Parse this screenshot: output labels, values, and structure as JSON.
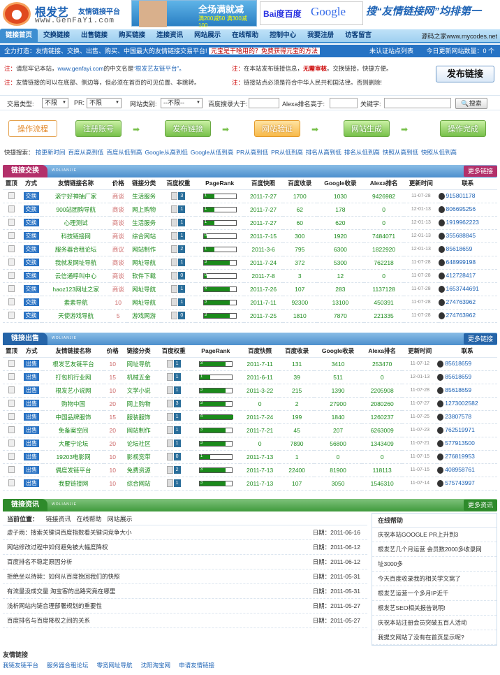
{
  "header": {
    "brand": "根发艺",
    "brand_sub": "友情链接平台",
    "brand_url": "www.GenFaYi.com",
    "ad1_title": "全场满就减",
    "ad1_sub": "满200减50 满300减100",
    "ad_baidu": "Bai度百度",
    "ad_google": "Google",
    "slogan": "搜“友情链接网”均排第一"
  },
  "nav": {
    "items": [
      "链接首页",
      "交换链接",
      "出售链接",
      "购买链接",
      "连接资讯",
      "网站展示",
      "在线帮助",
      "控制中心",
      "我要注册",
      "访客留言"
    ],
    "right": "源码之家www.mycodes.net"
  },
  "tagbar": {
    "text": "全力打造：友情链接、交换、出售、购买、中国最大的友情链接交易平台!",
    "highlight": "元宝是干啥用的？免费获得元宝的方法",
    "right1": "未认证站点列表",
    "right2": "今日更新网站数量：0 个"
  },
  "notices": [
    {
      "mark": "注：",
      "text": "请您牢记本站，",
      "url": "www.genfayi.com",
      "text2": "的中文名是",
      "name": "“根发艺友链平台”。"
    },
    {
      "mark": "注：",
      "text": "在本站发布链接信息，",
      "red": "无需审核",
      "text2": "。交换链接，快捷方便。"
    },
    {
      "mark": "注：",
      "text": "友情链接的可以在底部、侧边等，但必须在首页的可见位置、非跳转。"
    },
    {
      "mark": "注：",
      "text": "链接站点必须是符合中华人民共和国法律。否则删除!"
    }
  ],
  "publish_button": "发布链接",
  "filter": {
    "type_label": "交易类型:",
    "type_val": "不限",
    "pr_label": "PR:",
    "pr_val": "不限",
    "cat_label": "网站类别:",
    "cat_val": "--不限--",
    "baidu_label": "百度搜录大于:",
    "alexa_label": "Alexa排名高于:",
    "kw_label": "关键字:",
    "search": "搜索"
  },
  "flow": [
    "操作流程",
    "注册账号",
    "发布链接",
    "网站验证",
    "网站生成",
    "操作完成"
  ],
  "quick": {
    "label": "快捷搜索：",
    "links": [
      "按更新时间",
      "百度从高到低",
      "百度从低到高",
      "Google从高到低",
      "Google从低到高",
      "PR从高到低",
      "PR从低到高",
      "排名从高到低",
      "排名从低到高",
      "快照从高到低",
      "快照从低到高"
    ]
  },
  "exchange": {
    "title": "链接交换",
    "sub": "WOLIANJIE",
    "more": "更多链接",
    "cols": [
      "置顶",
      "方式",
      "友情链接名称",
      "价格",
      "链接分类",
      "百度权重",
      "PageRank",
      "百度快照",
      "百度收录",
      "Google收录",
      "Alexa排名",
      "更新时间",
      "联系"
    ],
    "rows": [
      {
        "mode": "交换",
        "name": "滚宁好神抽厂家",
        "price": "商谈",
        "cat": "生活服务",
        "bw": "3",
        "pr": "1",
        "snap": "2011-7-27",
        "bd": "1700",
        "gg": "1030",
        "alexa": "9426982",
        "upd": "11-07-28",
        "qq": "915801178"
      },
      {
        "mode": "交换",
        "name": "900站团购导航",
        "price": "商谈",
        "cat": "网上购物",
        "bw": "1",
        "pr": "1",
        "snap": "2011-7-27",
        "bd": "62",
        "gg": "178",
        "alexa": "0",
        "upd": "12-01-13",
        "qq": "806695256"
      },
      {
        "mode": "交换",
        "name": "心理测试",
        "price": "商谈",
        "cat": "生活服务",
        "bw": "1",
        "pr": "1",
        "snap": "2011-7-27",
        "bd": "60",
        "gg": "620",
        "alexa": "0",
        "upd": "12-01-13",
        "qq": "1919962223"
      },
      {
        "mode": "交换",
        "name": "科技链接网",
        "price": "商谈",
        "cat": "综合网站",
        "bw": "1",
        "pr": "0",
        "snap": "2011-7-15",
        "bd": "300",
        "gg": "1920",
        "alexa": "7484071",
        "upd": "12-01-13",
        "qq": "355688845"
      },
      {
        "mode": "交换",
        "name": "服务器合租论坛",
        "price": "商议",
        "cat": "网站制作",
        "bw": "2",
        "pr": "1",
        "snap": "2011-3-6",
        "bd": "795",
        "gg": "6300",
        "alexa": "1822920",
        "upd": "12-01-13",
        "qq": "85618659"
      },
      {
        "mode": "交换",
        "name": "我就发网址导航",
        "price": "商谈",
        "cat": "网址导航",
        "bw": "1",
        "pr": "3",
        "snap": "2011-7-24",
        "bd": "372",
        "gg": "5300",
        "alexa": "762218",
        "upd": "11-07-28",
        "qq": "648999198"
      },
      {
        "mode": "交换",
        "name": "云信通呼叫中心",
        "price": "商谈",
        "cat": "软件下载",
        "bw": "0",
        "pr": "0",
        "snap": "2011-7-8",
        "bd": "3",
        "gg": "12",
        "alexa": "0",
        "upd": "11-07-28",
        "qq": "412728417"
      },
      {
        "mode": "交换",
        "name": "haoz123网址之家",
        "price": "商谈",
        "cat": "网址导航",
        "bw": "1",
        "pr": "3",
        "snap": "2011-7-26",
        "bd": "107",
        "gg": "283",
        "alexa": "1137128",
        "upd": "11-07-28",
        "qq": "1653744691"
      },
      {
        "mode": "交换",
        "name": "素素导航",
        "price": "10",
        "cat": "网址导航",
        "bw": "1",
        "pr": "3",
        "snap": "2011-7-11",
        "bd": "92300",
        "gg": "13100",
        "alexa": "450391",
        "upd": "11-07-28",
        "qq": "274763962"
      },
      {
        "mode": "交换",
        "name": "天使游戏导航",
        "price": "5",
        "cat": "游戏网游",
        "bw": "0",
        "pr": "3",
        "snap": "2011-7-25",
        "bd": "1810",
        "gg": "7870",
        "alexa": "221335",
        "upd": "11-07-28",
        "qq": "274763962"
      }
    ]
  },
  "sale": {
    "title": "链接出售",
    "sub": "WOLIANJIE",
    "more": "更多链接",
    "cols": [
      "置顶",
      "方式",
      "友情链接名称",
      "价格",
      "链接分类",
      "百度权重",
      "PageRank",
      "百度快照",
      "百度收录",
      "Google收录",
      "Alexa排名",
      "更新时间",
      "联系"
    ],
    "rows": [
      {
        "mode": "出售",
        "name": "根发艺友链平台",
        "price": "10",
        "cat": "网址导航",
        "bw": "1",
        "pr": "3",
        "snap": "2011-7-11",
        "bd": "131",
        "gg": "3410",
        "alexa": "253470",
        "upd": "11-07-12",
        "qq": "85618659"
      },
      {
        "mode": "出售",
        "name": "打包机行业网",
        "price": "15",
        "cat": "机械五金",
        "bw": "1",
        "pr": "1",
        "snap": "2011-6-11",
        "bd": "39",
        "gg": "511",
        "alexa": "0",
        "upd": "12-01-13",
        "qq": "85618659"
      },
      {
        "mode": "出售",
        "name": "根发艺小说网",
        "price": "10",
        "cat": "文学小说",
        "bw": "1",
        "pr": "3",
        "snap": "2011-3-22",
        "bd": "215",
        "gg": "1390",
        "alexa": "2205908",
        "upd": "11-07-28",
        "qq": "85618659"
      },
      {
        "mode": "出售",
        "name": "购物中国",
        "price": "20",
        "cat": "网上购物",
        "bw": "3",
        "pr": "3",
        "snap": "0",
        "bd": "2",
        "gg": "27900",
        "alexa": "2080260",
        "upd": "11-07-27",
        "qq": "1273002582"
      },
      {
        "mode": "出售",
        "name": "中国品牌服饰",
        "price": "15",
        "cat": "服装服饰",
        "bw": "1",
        "pr": "4",
        "snap": "2011-7-24",
        "bd": "199",
        "gg": "1840",
        "alexa": "1260237",
        "upd": "11-07-25",
        "qq": "23807578"
      },
      {
        "mode": "出售",
        "name": "免备案空间",
        "price": "20",
        "cat": "网站制作",
        "bw": "1",
        "pr": "3",
        "snap": "2011-7-21",
        "bd": "45",
        "gg": "207",
        "alexa": "6263009",
        "upd": "11-07-23",
        "qq": "762519971"
      },
      {
        "mode": "出售",
        "name": "大雁宁论坛",
        "price": "20",
        "cat": "论坛社区",
        "bw": "1",
        "pr": "3",
        "snap": "0",
        "bd": "7890",
        "gg": "56800",
        "alexa": "1343409",
        "upd": "11-07-21",
        "qq": "577913500"
      },
      {
        "mode": "出售",
        "name": "19203电影网",
        "price": "10",
        "cat": "影视宽带",
        "bw": "0",
        "pr": "1",
        "snap": "2011-7-13",
        "bd": "1",
        "gg": "0",
        "alexa": "0",
        "upd": "11-07-15",
        "qq": "276819953"
      },
      {
        "mode": "出售",
        "name": "偶度发链平台",
        "price": "10",
        "cat": "免费资源",
        "bw": "2",
        "pr": "3",
        "snap": "2011-7-13",
        "bd": "22400",
        "gg": "81900",
        "alexa": "118113",
        "upd": "11-07-15",
        "qq": "408958761"
      },
      {
        "mode": "出售",
        "name": "我要链接网",
        "price": "10",
        "cat": "综合网站",
        "bw": "1",
        "pr": "3",
        "snap": "2011-7-13",
        "bd": "107",
        "gg": "3050",
        "alexa": "1546310",
        "upd": "11-07-14",
        "qq": "575743997"
      }
    ]
  },
  "news_sec": {
    "title": "链接资讯",
    "sub": "WOLIANJIE",
    "more": "更多资讯"
  },
  "news": {
    "crumb_label": "当前位置：",
    "crumbs": [
      "链接资讯",
      "在线帮助",
      "网站展示"
    ],
    "date_label": "日期：",
    "rows": [
      {
        "t": "虚子雨：搜索关键词百度指数看关键词竞争大小",
        "d": "2011-06-16"
      },
      {
        "t": "网站修改过程中如何避免被大幅度降权",
        "d": "2011-06-12"
      },
      {
        "t": "百度排名不稳定原因分析",
        "d": "2011-06-12"
      },
      {
        "t": "拒绝坐以待毙：如何从百度挽回我们的快照",
        "d": "2011-05-31"
      },
      {
        "t": "有流量没成交量 淘宝客的出路究竟在哪里",
        "d": "2011-05-31"
      },
      {
        "t": "浅析网站内链合理部署规划的重要性",
        "d": "2011-05-27"
      },
      {
        "t": "百度排名与百度降权之间的关系",
        "d": "2011-05-27"
      }
    ]
  },
  "help": {
    "title": "在线帮助",
    "rows": [
      "庆祝本站GOOGLE PR上升到3",
      "根发艺几个月运营 会员数2000多收录网",
      "址3000多",
      "今天百度收录我的相关学文窝了",
      "根发艺运营一个多月IP近千",
      "根发艺SEO相关报告说明!",
      "庆祝本站注册会员突破五百人活动",
      "我提交网站了没有在首页显示呢?"
    ]
  },
  "friend": {
    "title": "友情链接",
    "links": [
      "我链友链平台",
      "服务器合租论坛",
      "零宽网址导航",
      "沈阳淘宝网",
      "申请友情链接"
    ]
  },
  "colors": {
    "accent": "#2673c4",
    "green": "#1e8c1e",
    "red": "#c00"
  }
}
